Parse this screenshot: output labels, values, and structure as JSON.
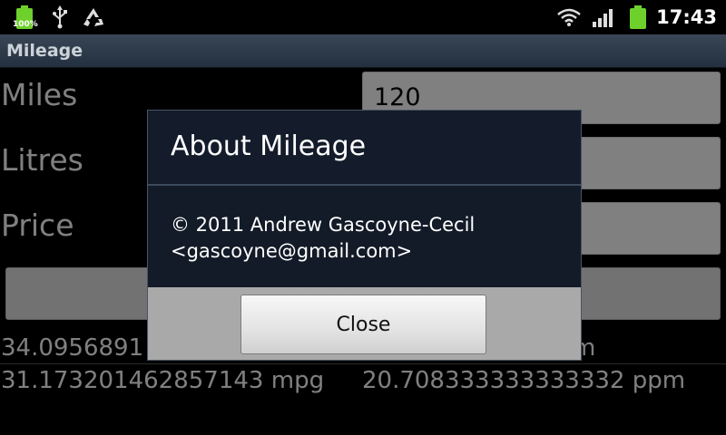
{
  "status_bar": {
    "battery_percent_label": "100%",
    "time": "17:43",
    "icons": [
      "battery-full-icon",
      "usb-icon",
      "recycle-icon",
      "wifi-icon",
      "signal-icon",
      "battery-icon"
    ]
  },
  "app": {
    "title": "Mileage"
  },
  "form": {
    "miles_label": "Miles",
    "miles_value": "120",
    "litres_label": "Litres",
    "price_label": "Price"
  },
  "results": [
    {
      "mpg": "34.0956891 mpg",
      "ppm": "ppm"
    },
    {
      "mpg": "31.173201462857143 mpg",
      "ppm": "20.708333333333332 ppm"
    }
  ],
  "dialog": {
    "title": "About Mileage",
    "body_line1": "© 2011 Andrew Gascoyne-Cecil",
    "body_line2": "<gascoyne@gmail.com>",
    "close_label": "Close"
  },
  "colors": {
    "battery": "#6ed12b",
    "title_bar": "#2c3a4a",
    "dialog_bg": "#131b28"
  }
}
